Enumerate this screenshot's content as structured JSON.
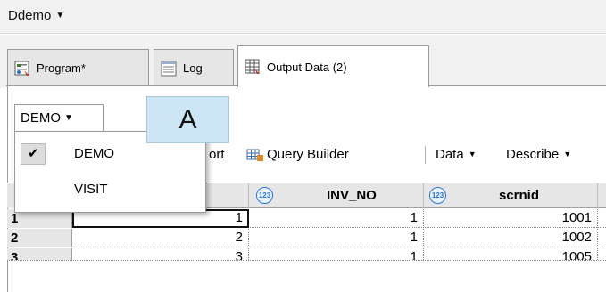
{
  "project": {
    "name": "Ddemo"
  },
  "tabs": [
    {
      "label": "Program*",
      "icon": "program-icon"
    },
    {
      "label": "Log",
      "icon": "log-icon"
    },
    {
      "label": "Output Data (2)",
      "icon": "output-data-icon"
    }
  ],
  "table_select": {
    "value": "DEMO"
  },
  "dropdown": {
    "items": [
      {
        "label": "DEMO",
        "selected": true
      },
      {
        "label": "VISIT",
        "selected": false
      }
    ]
  },
  "callout": {
    "label": "A"
  },
  "toolbar": {
    "export_partial": "ort",
    "query_builder": "Query Builder",
    "data": "Data",
    "describe": "Describe"
  },
  "grid": {
    "columns": [
      {
        "name": "INV_NO",
        "icon": "numeric-column-icon",
        "icon_text": "123"
      },
      {
        "name": "scrnid",
        "icon": "numeric-column-icon",
        "icon_text": "123"
      }
    ],
    "rows": [
      {
        "n": "1",
        "c0": "1",
        "c1": "1",
        "c2": "1001"
      },
      {
        "n": "2",
        "c0": "2",
        "c1": "1",
        "c2": "1002"
      },
      {
        "n": "3",
        "c0": "3",
        "c1": "1",
        "c2": "1005"
      }
    ]
  },
  "colors": {
    "callout_bg": "#cce6f6",
    "numeric_icon": "#2a74d8",
    "header_bg": "#e6e6e6"
  }
}
